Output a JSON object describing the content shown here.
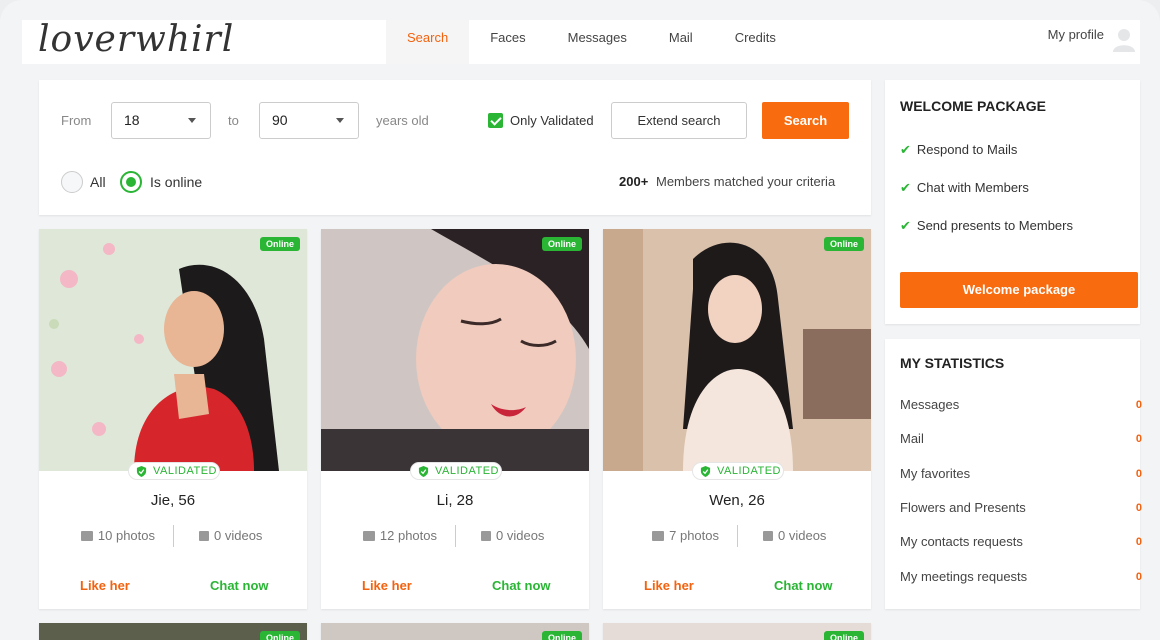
{
  "brand": {
    "logo_text": "loverwhirl"
  },
  "nav": {
    "items": [
      {
        "label": "Search",
        "active": true
      },
      {
        "label": "Faces",
        "active": false
      },
      {
        "label": "Messages",
        "active": false
      },
      {
        "label": "Mail",
        "active": false
      },
      {
        "label": "Credits",
        "active": false
      }
    ],
    "profile_label": "My profile"
  },
  "search": {
    "from_label": "From",
    "from_value": "18",
    "to_label": "to",
    "to_value": "90",
    "years_label": "years old",
    "only_validated_label": "Only Validated",
    "only_validated_checked": true,
    "extend_label": "Extend search",
    "search_button": "Search",
    "radio_all": "All",
    "radio_online": "Is online",
    "radio_selected": "Is online",
    "match_count": "200+",
    "match_text": "Members matched your criteria"
  },
  "profiles": [
    {
      "name": "Jie, 56",
      "status": "Online",
      "badge": "VALIDATED",
      "photos": "10 photos",
      "videos": "0 videos",
      "like": "Like her",
      "chat": "Chat now"
    },
    {
      "name": "Li, 28",
      "status": "Online",
      "badge": "VALIDATED",
      "photos": "12 photos",
      "videos": "0 videos",
      "like": "Like her",
      "chat": "Chat now"
    },
    {
      "name": "Wen, 26",
      "status": "Online",
      "badge": "VALIDATED",
      "photos": "7 photos",
      "videos": "0 videos",
      "like": "Like her",
      "chat": "Chat now"
    }
  ],
  "next_row_status": [
    "Online",
    "Online",
    "Online"
  ],
  "welcome": {
    "title": "WELCOME PACKAGE",
    "items": [
      "Respond to Mails",
      "Chat with Members",
      "Send presents to Members"
    ],
    "button": "Welcome package"
  },
  "statistics": {
    "title": "MY STATISTICS",
    "rows": [
      {
        "label": "Messages",
        "value": "0"
      },
      {
        "label": "Mail",
        "value": "0"
      },
      {
        "label": "My favorites",
        "value": "0"
      },
      {
        "label": "Flowers and Presents",
        "value": "0"
      },
      {
        "label": "My contacts requests",
        "value": "0"
      },
      {
        "label": "My meetings requests",
        "value": "0"
      }
    ]
  },
  "colors": {
    "accent": "#f86b0e",
    "online": "#2ab535"
  }
}
